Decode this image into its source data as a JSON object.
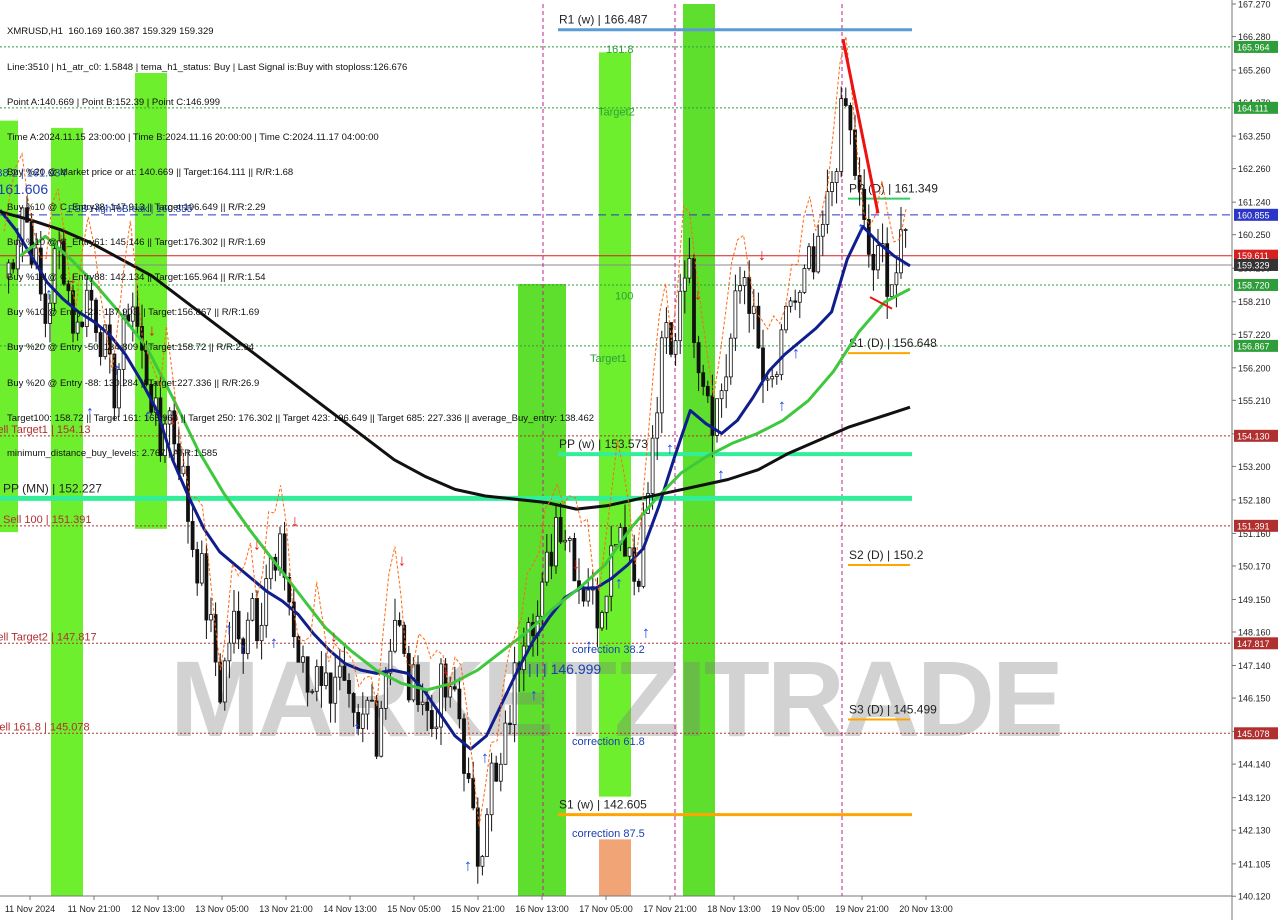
{
  "info_lines": [
    "XMRUSD,H1  160.169 160.387 159.329 159.329",
    "Line:3510 | h1_atr_c0: 1.5848 | tema_h1_status: Buy | Last Signal is:Buy with stoploss:126.676",
    "Point A:140.669 | Point B:152.39 | Point C:146.999",
    "Time A:2024.11.15 23:00:00 | Time B:2024.11.16 20:00:00 | Time C:2024.11.17 04:00:00",
    "Buy %20 @ Market price or at: 140.669 || Target:164.111 || R/R:1.68",
    "Buy %10 @ C_Entry38: 147.913 || Target:196.649 || R/R:2.29",
    "Buy %10 @ C_Entry61: 145.146 || Target:176.302 || R/R:1.69",
    "Buy %10 @ C_Entry88: 142.134 || Target:165.964 || R/R:1.54",
    "Buy %10 @ Entry -23: 137.903 || Target:156.867 || R/R:1.69",
    "Buy %20 @ Entry -50: 134.809 || Target:158.72 || R/R:2.94",
    "Buy %20 @ Entry -88: 130.284 || Target:227.336 || R/R:26.9",
    "Target100: 158.72 || Target 161: 165.964 || Target 250: 176.302 || Target 423: 196.649 || Target 685: 227.336 || average_Buy_entry: 138.462",
    "minimum_distance_buy_levels: 2.767 | ATR:1.585"
  ],
  "watermark": "MARKETZITRADE",
  "chart_data": {
    "type": "candlestick",
    "symbol": "XMRUSD",
    "timeframe": "H1",
    "ohlc_header": {
      "open": 160.169,
      "high": 160.387,
      "low": 159.329,
      "close": 159.329
    },
    "ylim": [
      140.127,
      167.27
    ],
    "yticks": [
      140.12,
      141.105,
      142.13,
      143.12,
      144.14,
      145.13,
      146.15,
      147.14,
      148.16,
      149.15,
      150.17,
      151.16,
      152.18,
      153.2,
      154.19,
      155.21,
      156.2,
      157.22,
      158.21,
      159.23,
      160.25,
      161.24,
      162.26,
      163.25,
      164.27,
      165.26,
      166.28,
      167.27
    ],
    "ytick_labels": [
      "140.120",
      "141.105",
      "142.130",
      "143.120",
      "144.140",
      "145.130",
      "146.150",
      "147.140",
      "148.160",
      "149.150",
      "150.170",
      "151.160",
      "152.180",
      "153.200",
      "154.190",
      "155.210",
      "156.200",
      "157.220",
      "158.210",
      "159.230",
      "160.250",
      "161.240",
      "162.260",
      "163.250",
      "164.270",
      "165.260",
      "166.280",
      "167.270"
    ],
    "xtick_labels": [
      "11 Nov 2024",
      "11 Nov 21:00",
      "12 Nov 13:00",
      "13 Nov 05:00",
      "13 Nov 21:00",
      "14 Nov 13:00",
      "15 Nov 05:00",
      "15 Nov 21:00",
      "16 Nov 13:00",
      "17 Nov 05:00",
      "17 Nov 21:00",
      "18 Nov 13:00",
      "19 Nov 05:00",
      "19 Nov 21:00",
      "20 Nov 13:00"
    ],
    "price_badges": [
      {
        "value": 165.964,
        "label": "165.964",
        "color": "#2e9e3a"
      },
      {
        "value": 164.111,
        "label": "164.111",
        "color": "#2e9e3a"
      },
      {
        "value": 160.855,
        "label": "160.855",
        "color": "#2b36c8"
      },
      {
        "value": 159.611,
        "label": "159.611",
        "color": "#d62020"
      },
      {
        "value": 159.329,
        "label": "159.329",
        "color": "#333333"
      },
      {
        "value": 158.72,
        "label": "158.720",
        "color": "#2e9e3a"
      },
      {
        "value": 156.867,
        "label": "156.867",
        "color": "#2e9e3a"
      },
      {
        "value": 154.13,
        "label": "154.130",
        "color": "#b03030"
      },
      {
        "value": 151.391,
        "label": "151.391",
        "color": "#b03030"
      },
      {
        "value": 147.817,
        "label": "147.817",
        "color": "#b03030"
      },
      {
        "value": 145.078,
        "label": "145.078",
        "color": "#b03030"
      }
    ],
    "pivot_levels": [
      {
        "label": "R1 (w) | 166.487",
        "value": 166.487,
        "color": "#5b9bd5"
      },
      {
        "label": "PP (w) | 153.573",
        "value": 153.573,
        "color": "#33ee99"
      },
      {
        "label": "PP (MN) | 152.227",
        "value": 152.227,
        "color": "#33ee99"
      },
      {
        "label": "S1 (w) | 142.605",
        "value": 142.605,
        "color": "#ffa500"
      },
      {
        "label": "PP (D) | 161.349",
        "value": 161.349,
        "color": "#33cc66"
      },
      {
        "label": "S1 (D) | 156.648",
        "value": 156.648,
        "color": "#ffa500"
      },
      {
        "label": "S2 (D) | 150.2",
        "value": 150.2,
        "color": "#ffa500"
      },
      {
        "label": "S3 (D) | 145.499",
        "value": 145.499,
        "color": "#ffa500"
      }
    ],
    "text_labels": [
      {
        "text": "Sell Target1 | 154.13",
        "value": 154.13,
        "color": "#b03030"
      },
      {
        "text": "Sell 100 | 151.391",
        "value": 151.391,
        "color": "#b03030"
      },
      {
        "text": "Sell Target2 | 147.817",
        "value": 147.817,
        "color": "#b03030"
      },
      {
        "text": "Sell 161.8 | 145.078",
        "value": 145.078,
        "color": "#b03030"
      },
      {
        "text": "correction 38.2 | 161.934",
        "value": 161.934,
        "color": "#1a3fb0"
      },
      {
        "text": "FSB-HighToBreak | 160.855",
        "value": 160.855,
        "color": "#1a3fb0"
      },
      {
        "text": "| 161.606",
        "value": 161.606,
        "color": "#1a3fb0"
      },
      {
        "text": "161.8",
        "value": 165.9,
        "color": "#2e9e3a"
      },
      {
        "text": "Target2",
        "value": 164.0,
        "color": "#2e9e3a"
      },
      {
        "text": "100",
        "value": 158.4,
        "color": "#2e9e3a"
      },
      {
        "text": "Target1",
        "value": 156.5,
        "color": "#2e9e3a"
      },
      {
        "text": "correction 38.2",
        "value": 147.65,
        "color": "#1a3fb0"
      },
      {
        "text": "correction 61.8",
        "value": 144.85,
        "color": "#1a3fb0"
      },
      {
        "text": "correction 87.5",
        "value": 142.05,
        "color": "#1a3fb0"
      },
      {
        "text": "| | | 146.999",
        "value": 146.999,
        "color": "#1a3fb0"
      }
    ],
    "series": [
      {
        "name": "price",
        "values": [
          158.95,
          159.4,
          160.2,
          161.2,
          160.5,
          159.7,
          158.4,
          157.6,
          159.0,
          159.9,
          159.4,
          158.2,
          157.1,
          158.0,
          158.6,
          158.0,
          157.3,
          156.7,
          155.3,
          156.1,
          157.2,
          158.6,
          157.6,
          156.4,
          155.9,
          154.8,
          153.6,
          155.3,
          154.4,
          153.6,
          152.6,
          151.2,
          150.4,
          149.8,
          148.5,
          147.5,
          146.4,
          147.4,
          148.6,
          147.7,
          148.2,
          149.6,
          148.5,
          149.2,
          150.4,
          149.7,
          150.5,
          149.9,
          148.2,
          147.3,
          146.7,
          146.1,
          147.5,
          146.8,
          146.3,
          147.2,
          146.6,
          145.8,
          145.1,
          144.6,
          145.6,
          146.2,
          145.1,
          146.5,
          147.8,
          148.7,
          147.9,
          146.5,
          146.4,
          146.8,
          145.9,
          145.2,
          146.0,
          146.6,
          145.8,
          146.3,
          145.3,
          143.6,
          142.2,
          141.2,
          142.8,
          143.9,
          143.2,
          144.3,
          145.6,
          146.8,
          147.9,
          149.2,
          148.8,
          148.5,
          149.8,
          150.7,
          151.9,
          151.4,
          151.1,
          150.3,
          149.3,
          149.9,
          149.0,
          148.8,
          149.9,
          150.6,
          151.8,
          151.2,
          150.8,
          149.6,
          150.9,
          152.3,
          153.9,
          155.8,
          157.4,
          156.3,
          157.9,
          159.8,
          158.9,
          157.2,
          156.3,
          155.7,
          154.7,
          155.4,
          156.0,
          157.2,
          158.3,
          159.2,
          158.4,
          157.0,
          156.0,
          155.2,
          155.8,
          156.3,
          157.4,
          158.6,
          157.9,
          158.7,
          159.3,
          158.9,
          160.2,
          161.1,
          162.3,
          163.5,
          164.1,
          162.9,
          161.6,
          160.3,
          159.5,
          159.1,
          159.7,
          159.0,
          158.9,
          159.5,
          160.2
        ]
      },
      {
        "name": "blue ma",
        "values": [
          161.0,
          160.4,
          159.6,
          158.8,
          158.3,
          157.9,
          157.6,
          157.2,
          156.6,
          155.8,
          154.9,
          153.4,
          152.3,
          151.3,
          150.6,
          150.2,
          149.8,
          149.4,
          149.1,
          148.7,
          148.1,
          147.6,
          147.2,
          147.0,
          146.9,
          147.0,
          146.9,
          146.4,
          145.7,
          145.0,
          144.6,
          145.0,
          146.0,
          147.0,
          147.9,
          148.6,
          149.2,
          149.5,
          149.5,
          149.8,
          150.2,
          150.7,
          152.0,
          153.5,
          154.9,
          154.5,
          154.2,
          154.6,
          155.3,
          156.1,
          156.6,
          157.0,
          157.4,
          157.9,
          159.5,
          160.5,
          160.0,
          159.6,
          159.3
        ]
      },
      {
        "name": "green ma",
        "values": [
          159.6,
          160.2,
          159.5,
          158.7,
          157.8,
          156.8,
          155.3,
          153.7,
          152.4,
          151.3,
          150.3,
          149.3,
          148.3,
          147.6,
          147.0,
          146.6,
          146.4,
          146.6,
          147.0,
          147.6,
          148.2,
          148.9,
          149.5,
          150.2,
          151.3,
          152.2,
          153.0,
          153.5,
          153.9,
          154.2,
          154.6,
          155.2,
          156.1,
          157.3,
          158.2,
          158.6
        ]
      },
      {
        "name": "black ma",
        "values": [
          160.95,
          160.7,
          160.4,
          160.0,
          159.5,
          159.0,
          158.3,
          157.6,
          156.9,
          156.2,
          155.5,
          154.8,
          154.1,
          153.4,
          152.9,
          152.5,
          152.3,
          152.2,
          152.1,
          151.9,
          152.0,
          152.2,
          152.4,
          152.6,
          152.8,
          153.1,
          153.6,
          154.0,
          154.4,
          154.7,
          155.0
        ]
      }
    ]
  }
}
